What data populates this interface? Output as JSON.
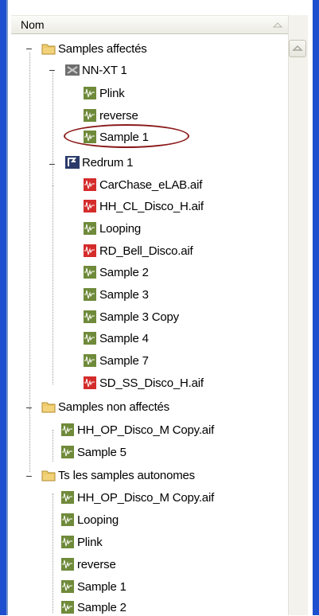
{
  "header": {
    "column_label": "Nom"
  },
  "tree": {
    "folder_assigned": "Samples affectés",
    "nnxt": "NN-XT 1",
    "nnxt_items": [
      "Plink",
      "reverse",
      "Sample 1"
    ],
    "redrum": "Redrum 1",
    "redrum_items": [
      "CarChase_eLAB.aif",
      "HH_CL_Disco_H.aif",
      "Looping",
      "RD_Bell_Disco.aif",
      "Sample 2",
      "Sample 3",
      "Sample 3 Copy",
      "Sample 4",
      "Sample 7",
      "SD_SS_Disco_H.aif"
    ],
    "folder_unassigned": "Samples non affectés",
    "unassigned_items": [
      "HH_OP_Disco_M Copy.aif",
      "Sample 5"
    ],
    "folder_all": "Ts les samples autonomes",
    "all_items": [
      "HH_OP_Disco_M Copy.aif",
      "Looping",
      "Plink",
      "reverse",
      "Sample 1",
      "Sample 2"
    ]
  },
  "colors": {
    "frame": "#1e4fcf",
    "folder": "#f2d27a",
    "sample_green": "#6f8a3a",
    "sample_red": "#d42b2b",
    "highlight": "#8b1a1a"
  },
  "icons": [
    "minus-expander-icon",
    "folder-icon",
    "nnxt-device-icon",
    "redrum-device-icon",
    "sample-icon",
    "sample-file-icon",
    "sort-arrow-icon"
  ]
}
